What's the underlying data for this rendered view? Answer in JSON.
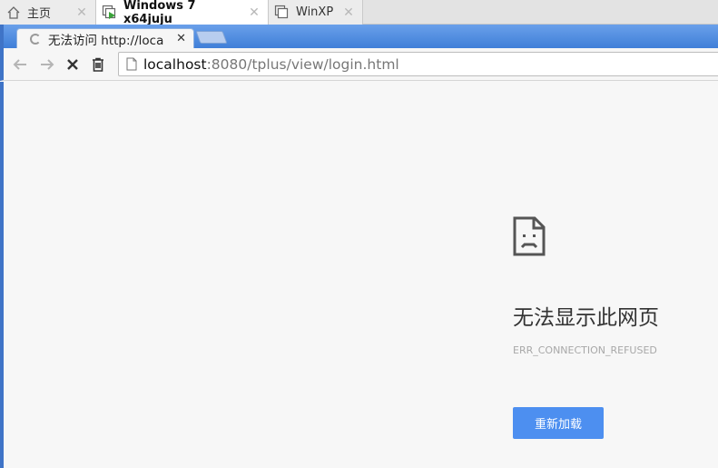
{
  "host_tabs": [
    {
      "label": "主页",
      "icon": "home-icon",
      "active": false
    },
    {
      "label": "Windows 7 x64juju",
      "icon": "vm-running-icon",
      "active": true
    },
    {
      "label": "WinXP",
      "icon": "vm-icon",
      "active": false
    }
  ],
  "browser": {
    "tab_title": "无法访问 http://loca",
    "address": {
      "host": "localhost",
      "rest": ":8080/tplus/view/login.html"
    }
  },
  "error_page": {
    "title": "无法显示此网页",
    "code": "ERR_CONNECTION_REFUSED",
    "reload_label": "重新加载"
  },
  "colors": {
    "accent": "#4d8ff0",
    "chrome_frame": "#4f8de0"
  }
}
